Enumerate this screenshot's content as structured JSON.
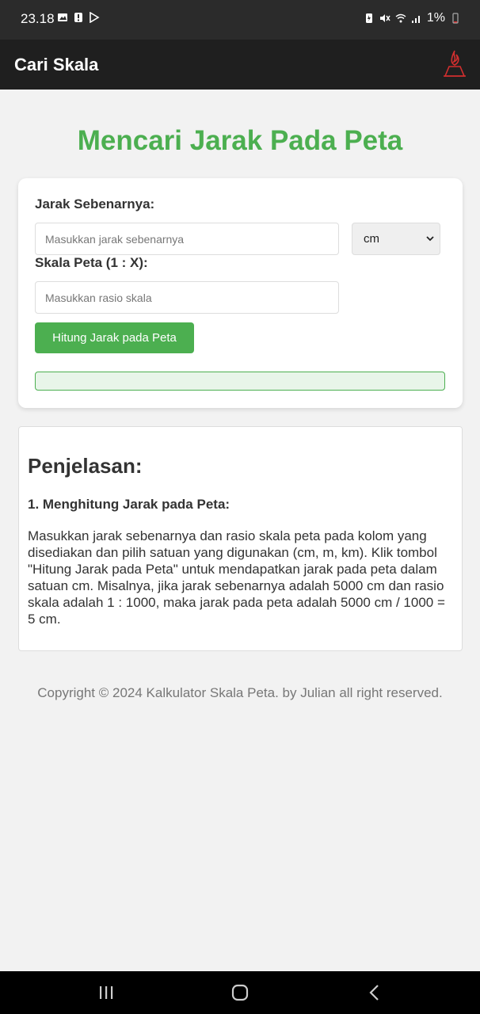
{
  "status_bar": {
    "time": "23.18",
    "battery": "1%"
  },
  "app_bar": {
    "title": "Cari Skala",
    "logo_icon": "fire-logo-icon"
  },
  "page": {
    "heading": "Mencari Jarak Pada Peta"
  },
  "form": {
    "distance_label": "Jarak Sebenarnya:",
    "distance_placeholder": "Masukkan jarak sebenarnya",
    "unit_selected": "cm",
    "scale_label": "Skala Peta (1 : X):",
    "scale_placeholder": "Masukkan rasio skala",
    "calculate_button": "Hitung Jarak pada Peta",
    "result": ""
  },
  "explanation": {
    "title": "Penjelasan:",
    "subtitle": "1. Menghitung Jarak pada Peta:",
    "body": "Masukkan jarak sebenarnya dan rasio skala peta pada kolom yang disediakan dan pilih satuan yang digunakan (cm, m, km). Klik tombol \"Hitung Jarak pada Peta\" untuk mendapatkan jarak pada peta dalam satuan cm. Misalnya, jika jarak sebenarnya adalah 5000 cm dan rasio skala adalah 1 : 1000, maka jarak pada peta adalah 5000 cm / 1000 = 5 cm."
  },
  "footer": {
    "text": "Copyright © 2024 Kalkulator Skala Peta. by Julian all right reserved."
  },
  "colors": {
    "accent": "#4caf50",
    "result_bg": "#e8f5e9",
    "app_bar": "#1f1f1f",
    "logo": "#d32f2f"
  }
}
